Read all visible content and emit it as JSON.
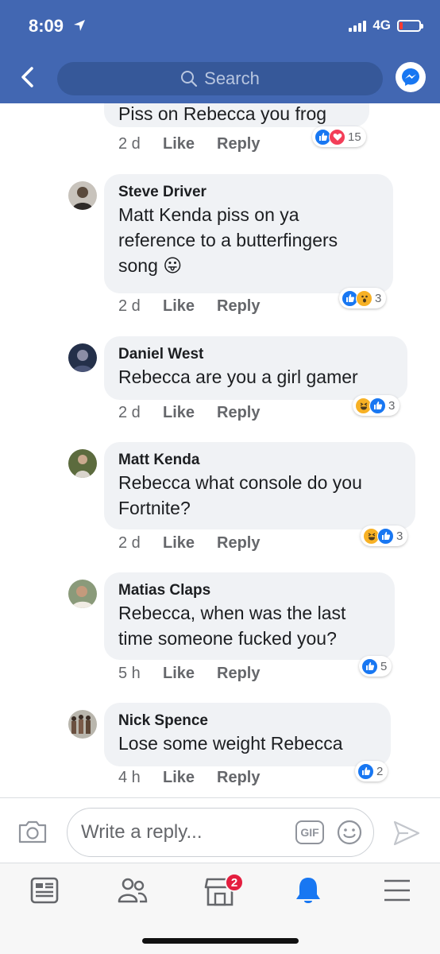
{
  "status_bar": {
    "time": "8:09",
    "network": "4G"
  },
  "header": {
    "search_placeholder": "Search"
  },
  "actions": {
    "like": "Like",
    "reply": "Reply"
  },
  "comments": [
    {
      "author": "",
      "text": "Piss on Rebecca you frog",
      "time": "2 d",
      "reactions": [
        "like",
        "love"
      ],
      "reaction_count": "15"
    },
    {
      "author": "Steve Driver",
      "text": "Matt Kenda piss on ya reference to a butterfingers song 😛",
      "time": "2 d",
      "reactions": [
        "like",
        "wow"
      ],
      "reaction_count": "3"
    },
    {
      "author": "Daniel West",
      "text": "Rebecca are you a girl gamer",
      "time": "2 d",
      "reactions": [
        "haha",
        "like"
      ],
      "reaction_count": "3"
    },
    {
      "author": "Matt Kenda",
      "text": "Rebecca what console do you Fortnite?",
      "time": "2 d",
      "reactions": [
        "haha",
        "like"
      ],
      "reaction_count": "3"
    },
    {
      "author": "Matias Claps",
      "text": "Rebecca, when was the last time someone fucked you?",
      "time": "5 h",
      "reactions": [
        "like"
      ],
      "reaction_count": "5"
    },
    {
      "author": "Nick Spence",
      "text": "Lose some weight Rebecca",
      "time": "4 h",
      "reactions": [
        "like"
      ],
      "reaction_count": "2"
    }
  ],
  "composer": {
    "placeholder": "Write a reply...",
    "gif_label": "GIF"
  },
  "tabbar": {
    "notifications_badge": "2"
  },
  "colors": {
    "brand": "#4267b2",
    "like": "#1877f2",
    "love": "#f33e58",
    "badge": "#e41e3f"
  }
}
